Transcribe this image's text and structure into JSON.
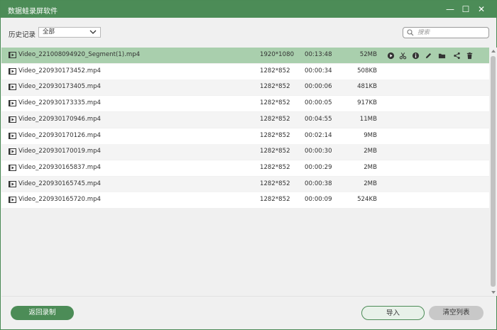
{
  "window": {
    "title": "数据蛙录屏软件",
    "controls": {
      "minimize": "—",
      "maximize": "☐",
      "close": "✕"
    }
  },
  "toolbar": {
    "history_label": "历史记录",
    "filter_value": "全部",
    "search_placeholder": "搜索"
  },
  "files": [
    {
      "name": "Video_221008094920_Segment(1).mp4",
      "resolution": "1920*1080",
      "duration": "00:13:48",
      "size": "52MB",
      "selected": true
    },
    {
      "name": "Video_220930173452.mp4",
      "resolution": "1282*852",
      "duration": "00:00:34",
      "size": "508KB"
    },
    {
      "name": "Video_220930173405.mp4",
      "resolution": "1282*852",
      "duration": "00:00:06",
      "size": "481KB"
    },
    {
      "name": "Video_220930173335.mp4",
      "resolution": "1282*852",
      "duration": "00:00:05",
      "size": "917KB"
    },
    {
      "name": "Video_220930170946.mp4",
      "resolution": "1282*852",
      "duration": "00:04:55",
      "size": "11MB"
    },
    {
      "name": "Video_220930170126.mp4",
      "resolution": "1282*852",
      "duration": "00:02:14",
      "size": "9MB"
    },
    {
      "name": "Video_220930170019.mp4",
      "resolution": "1282*852",
      "duration": "00:00:30",
      "size": "2MB"
    },
    {
      "name": "Video_220930165837.mp4",
      "resolution": "1282*852",
      "duration": "00:00:29",
      "size": "2MB"
    },
    {
      "name": "Video_220930165745.mp4",
      "resolution": "1282*852",
      "duration": "00:00:38",
      "size": "2MB"
    },
    {
      "name": "Video_220930165720.mp4",
      "resolution": "1282*852",
      "duration": "00:00:09",
      "size": "524KB"
    }
  ],
  "row_actions": [
    "play-icon",
    "scissors-icon",
    "info-icon",
    "pencil-icon",
    "folder-icon",
    "share-icon",
    "trash-icon"
  ],
  "footer": {
    "back_label": "返回录制",
    "import_label": "导入",
    "clear_label": "清空列表"
  },
  "colors": {
    "brand": "#4c8c57",
    "selected_row": "#a9cfad"
  }
}
